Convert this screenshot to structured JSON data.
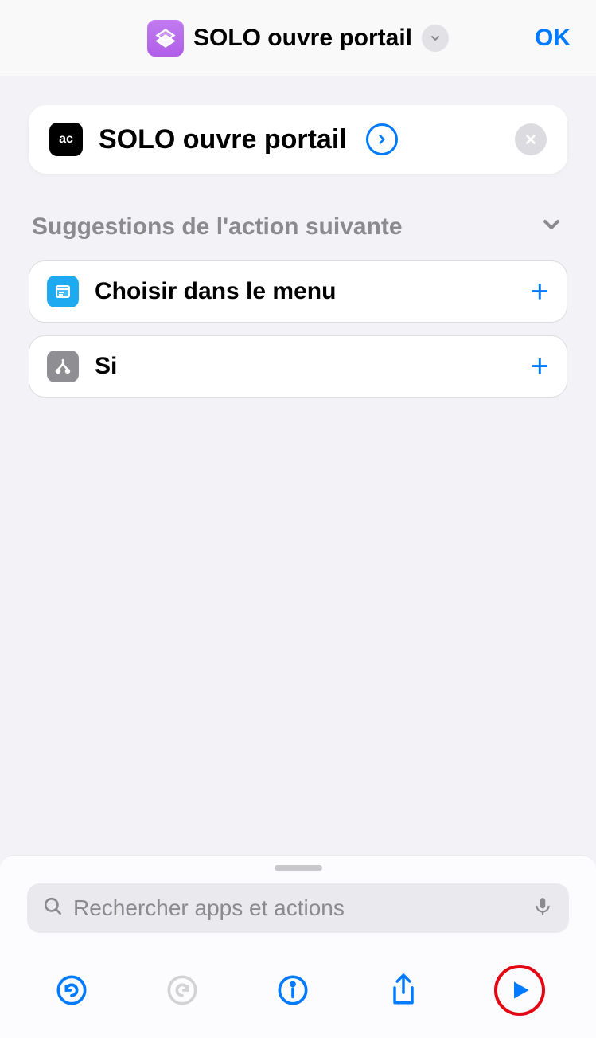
{
  "header": {
    "title": "SOLO ouvre portail",
    "ok_label": "OK"
  },
  "action": {
    "app_label": "ac",
    "title": "SOLO ouvre portail"
  },
  "suggestions": {
    "header": "Suggestions de l'action suivante",
    "items": [
      {
        "label": "Choisir dans le menu",
        "icon": "menu"
      },
      {
        "label": "Si",
        "icon": "branch"
      }
    ]
  },
  "search": {
    "placeholder": "Rechercher apps et actions"
  },
  "colors": {
    "accent": "#007aff",
    "shortcut_tint": "#b15ee8",
    "highlight_ring": "#e30613"
  }
}
